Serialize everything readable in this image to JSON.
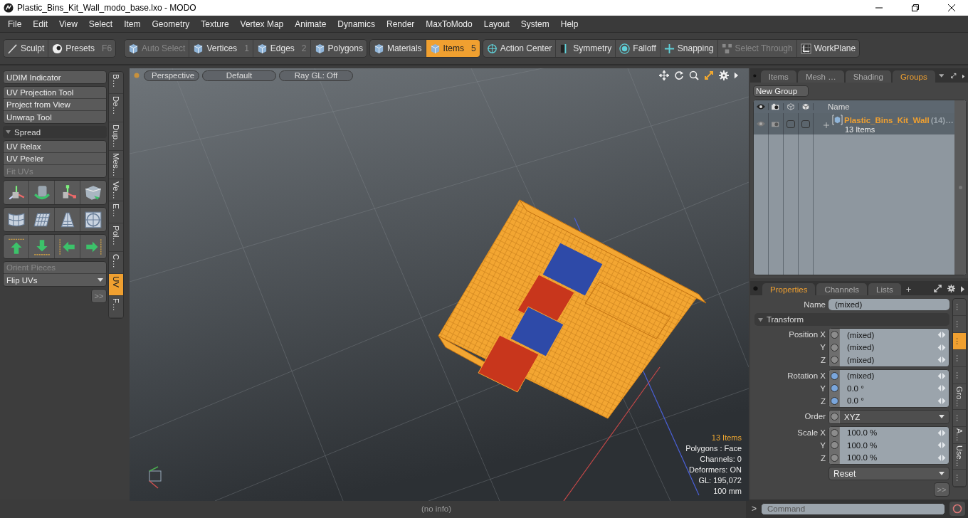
{
  "window": {
    "title": "Plastic_Bins_Kit_Wall_modo_base.lxo - MODO"
  },
  "menu": [
    "File",
    "Edit",
    "View",
    "Select",
    "Item",
    "Geometry",
    "Texture",
    "Vertex Map",
    "Animate",
    "Dynamics",
    "Render",
    "MaxToModo",
    "Layout",
    "System",
    "Help"
  ],
  "toolbar": [
    [
      {
        "label": "Sculpt",
        "selected": false,
        "disabled": false
      },
      {
        "label": "Presets",
        "shortcut": "F6",
        "selected": false,
        "disabled": false
      }
    ],
    [
      {
        "label": "Auto Select",
        "selected": false,
        "disabled": true
      },
      {
        "label": "Vertices",
        "shortcut": "1",
        "selected": false,
        "disabled": false
      },
      {
        "label": "Edges",
        "shortcut": "2",
        "selected": false,
        "disabled": false
      },
      {
        "label": "Polygons",
        "selected": false,
        "disabled": false
      }
    ],
    [
      {
        "label": "Materials",
        "selected": false,
        "disabled": false
      },
      {
        "label": "Items",
        "shortcut": "5",
        "selected": true,
        "disabled": false
      }
    ],
    [
      {
        "label": "Action Center",
        "selected": false,
        "disabled": false
      },
      {
        "label": "Symmetry",
        "selected": false,
        "disabled": false
      },
      {
        "label": "Falloff",
        "selected": false,
        "disabled": false
      },
      {
        "label": "Snapping",
        "selected": false,
        "disabled": false
      },
      {
        "label": "Select Through",
        "selected": false,
        "disabled": true
      },
      {
        "label": "WorkPlane",
        "selected": false,
        "disabled": false
      }
    ]
  ],
  "left_panel": {
    "groups": [
      {
        "kind": "list",
        "items": [
          {
            "label": "UDIM Indicator",
            "disabled": false
          }
        ]
      },
      {
        "kind": "list",
        "items": [
          {
            "label": "UV Projection Tool",
            "disabled": false
          },
          {
            "label": "Project from View",
            "disabled": false
          },
          {
            "label": "Unwrap Tool",
            "disabled": false
          }
        ]
      },
      {
        "kind": "header",
        "label": "Spread",
        "expanded": true
      },
      {
        "kind": "list",
        "items": [
          {
            "label": "UV Relax",
            "disabled": false
          },
          {
            "label": "UV Peeler",
            "disabled": false
          },
          {
            "label": "Fit UVs",
            "disabled": true
          }
        ]
      }
    ],
    "bottom": [
      {
        "kind": "button",
        "label": "Orient Pieces",
        "disabled": true
      },
      {
        "kind": "dropdown",
        "label": "Flip UVs",
        "disabled": false
      }
    ],
    "more_button": ">>",
    "tabs": [
      {
        "label": "B…",
        "selected": false
      },
      {
        "label": "De…",
        "selected": false
      },
      {
        "label": "Dup…",
        "selected": false
      },
      {
        "label": "Mes…",
        "selected": false
      },
      {
        "label": "Ve…",
        "selected": false
      },
      {
        "label": "E…",
        "selected": false
      },
      {
        "label": "Pol…",
        "selected": false
      },
      {
        "label": "C…",
        "selected": false
      },
      {
        "label": "UV",
        "selected": true
      },
      {
        "label": "F…",
        "selected": false
      }
    ]
  },
  "viewport": {
    "buttons": [
      "Perspective",
      "Default",
      "Ray GL: Off"
    ],
    "stats": [
      {
        "text": "13 Items",
        "highlight": true
      },
      {
        "text": "Polygons : Face",
        "highlight": false
      },
      {
        "text": "Channels: 0",
        "highlight": false
      },
      {
        "text": "Deformers: ON",
        "highlight": false
      },
      {
        "text": "GL: 195,072",
        "highlight": false
      },
      {
        "text": "100 mm",
        "highlight": false
      }
    ]
  },
  "status_bar": {
    "text": "(no info)"
  },
  "groups_panel": {
    "tabs": [
      {
        "label": "Items",
        "selected": false
      },
      {
        "label": "Mesh …",
        "selected": false
      },
      {
        "label": "Shading",
        "selected": false
      },
      {
        "label": "Groups",
        "selected": true
      }
    ],
    "new_group_button": "New Group",
    "name_column": "Name",
    "rows": [
      {
        "name": "Plastic_Bins_Kit_Wall",
        "count": "(14)…",
        "detail": "13 Items",
        "expanded": false,
        "checks": [
          {
            "checked": false
          },
          {
            "checked": false
          }
        ]
      }
    ]
  },
  "properties": {
    "tabs": [
      {
        "label": "Properties",
        "selected": true
      },
      {
        "label": "Channels",
        "selected": false
      },
      {
        "label": "Lists",
        "selected": false
      }
    ],
    "add_tab": "+",
    "name_label": "Name",
    "name_value": "(mixed)",
    "section": {
      "label": "Transform",
      "expanded": true
    },
    "groups": [
      {
        "rows": [
          {
            "kind": "value",
            "label": "Position X",
            "value": "(mixed)",
            "color": "#8c8c8c"
          },
          {
            "kind": "value",
            "label": "Y",
            "value": "(mixed)",
            "color": "#8c8c8c"
          },
          {
            "kind": "value",
            "label": "Z",
            "value": "(mixed)",
            "color": "#8c8c8c"
          }
        ]
      },
      {
        "rows": [
          {
            "kind": "value",
            "label": "Rotation X",
            "value": "(mixed)",
            "color": "#7aa6dc"
          },
          {
            "kind": "value",
            "label": "Y",
            "value": "0.0 °",
            "color": "#7aa6dc"
          },
          {
            "kind": "value",
            "label": "Z",
            "value": "0.0 °",
            "color": "#7aa6dc"
          }
        ]
      },
      {
        "rows": [
          {
            "kind": "dropdown",
            "label": "Order",
            "value": "XYZ",
            "color": "#8c8c8c"
          }
        ]
      },
      {
        "rows": [
          {
            "kind": "value",
            "label": "Scale X",
            "value": "100.0 %",
            "color": "#8c8c8c"
          },
          {
            "kind": "value",
            "label": "Y",
            "value": "100.0 %",
            "color": "#8c8c8c"
          },
          {
            "kind": "value",
            "label": "Z",
            "value": "100.0 %",
            "color": "#8c8c8c"
          }
        ]
      }
    ],
    "reset": "Reset",
    "more_button": ">>",
    "side_tabs": [
      {
        "label": "…",
        "selected": false
      },
      {
        "label": "…",
        "selected": false
      },
      {
        "label": "…",
        "selected": true
      },
      {
        "label": "…",
        "selected": false
      },
      {
        "label": "…",
        "selected": false
      },
      {
        "label": "Gro…",
        "selected": false
      },
      {
        "label": "…",
        "selected": false
      },
      {
        "label": "A…",
        "selected": false
      },
      {
        "label": "Use…",
        "selected": false
      },
      {
        "label": "…",
        "selected": false
      }
    ]
  },
  "command": {
    "prompt": ">",
    "placeholder": "Command"
  }
}
